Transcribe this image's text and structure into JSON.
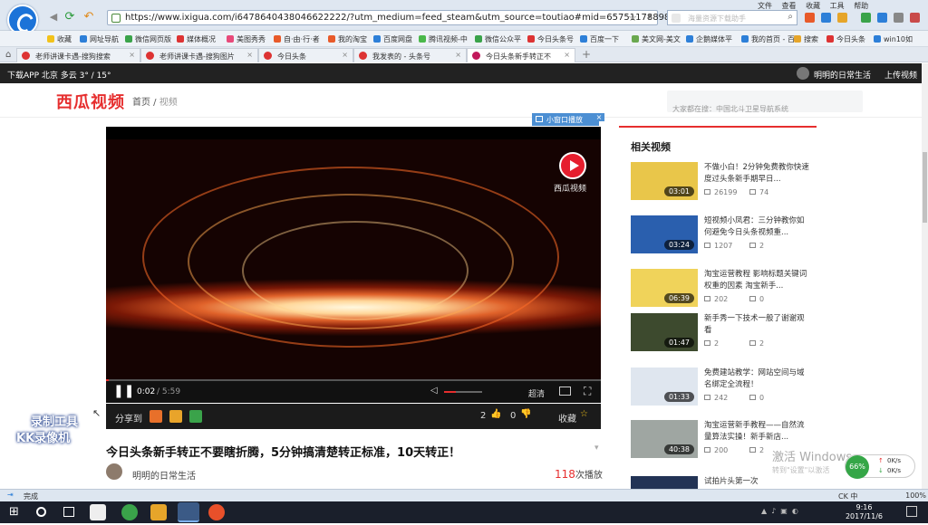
{
  "browser": {
    "url": "https://www.ixigua.com/i6478640438046622222/?utm_medium=feed_steam&utm_source=toutiao#mid=65751178898",
    "search_placeholder": "海量资源下载助手",
    "menus": [
      "文件",
      "查看",
      "收藏",
      "工具",
      "帮助"
    ],
    "bookmarks": [
      "收藏",
      "网址导航",
      "微信网页版",
      "媒体概况",
      "美图秀秀",
      "自·由·行·者",
      "我的淘宝",
      "百度网盘",
      "腾讯视频-中",
      "微信公众平",
      "今日头条号",
      "百度一下",
      "美文网-美文",
      "企鹅媒体平",
      "我的首页 - 百",
      "搜索",
      "今日头条",
      "win10如"
    ],
    "tabs": [
      {
        "label": "老师讲课卡遇-搜狗搜索",
        "active": false
      },
      {
        "label": "老师讲课卡遇-搜狗图片",
        "active": false
      },
      {
        "label": "今日头条",
        "active": false
      },
      {
        "label": "我发表的 - 头条号",
        "active": false
      },
      {
        "label": "今日头条新手转正不",
        "active": true
      }
    ]
  },
  "site": {
    "topbar_left": "下载APP   北京  多云   3° / 15°",
    "user": "明明的日常生活",
    "upload": "上传视频",
    "brand": "西瓜视频",
    "crumb_home": "首页",
    "crumb_sep": " / ",
    "crumb_current": "视频",
    "search_placeholder": "大家都在搜：中国北斗卫星导航系统"
  },
  "player": {
    "mini_label": "小窗口播放",
    "logo_label": "西瓜视频",
    "time_current": "0:02",
    "time_total": "/ 5:59",
    "quality": "超清",
    "progress_fraction": 0.006,
    "volume_fraction": 0.3,
    "share_label": "分享到",
    "likes": "2",
    "dislikes": "0",
    "collect": "收藏"
  },
  "video": {
    "title": "今日头条新手转正不要瞎折腾，5分钟搞清楚转正标准，10天转正！",
    "author": "明明的日常生活",
    "plays_count": "118",
    "plays_suffix": "次播放"
  },
  "related": {
    "heading": "相关视频",
    "items": [
      {
        "title": "不做小白！2分钟免费教你快速度过头条新手期早日...",
        "duration": "03:01",
        "plays": "26199",
        "comments": "74",
        "thumb": "#e9c64a"
      },
      {
        "title": "短视频小凤君：三分钟教你如何避免今日头条视频重...",
        "duration": "03:24",
        "plays": "1207",
        "comments": "2",
        "thumb": "#2a5fae"
      },
      {
        "title": "淘宝运营教程 影响标题关键词权重的因素 淘宝新手...",
        "duration": "06:39",
        "plays": "202",
        "comments": "0",
        "thumb": "#f0d35a"
      },
      {
        "title": "新手秀一下技术一般了谢谢观看",
        "duration": "01:47",
        "plays": "2",
        "comments": "2",
        "thumb": "#3d4a2e"
      },
      {
        "title": "免费建站教学：网站空间与域名绑定全流程！",
        "duration": "01:33",
        "plays": "242",
        "comments": "0",
        "thumb": "#dfe6ef"
      },
      {
        "title": "淘宝运营新手教程——自然流量算法实操！新手新店...",
        "duration": "40:38",
        "plays": "200",
        "comments": "2",
        "thumb": "#9fa6a2"
      },
      {
        "title": "试拍片头第一次",
        "duration": "",
        "plays": "",
        "comments": "",
        "thumb": "#223355"
      }
    ]
  },
  "overlay": {
    "watermark_line1": "录制工具",
    "watermark_line2": "KK录像机",
    "win_activate": "激活 Windows",
    "win_activate_sub": "转到\"设置\"以激活",
    "net_percent": "66%",
    "net_up": "0K/s",
    "net_down": "0K/s"
  },
  "status": {
    "text": "完成",
    "zoom": "100%"
  },
  "taskbar": {
    "time": "9:16",
    "date": "2017/11/6",
    "ime": "CK 中"
  },
  "colors": {
    "accent": "#e62e2e",
    "brand_red": "#e62e2e",
    "player_bg": "#000000"
  }
}
